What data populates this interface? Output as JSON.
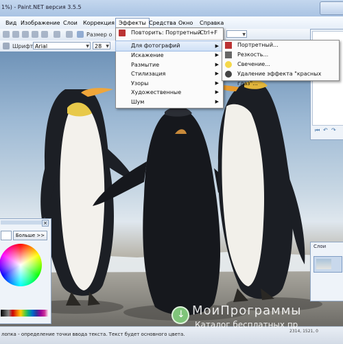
{
  "window": {
    "title": "1%) - Paint.NET версия 3.5.5"
  },
  "menu": [
    {
      "label": "Вид"
    },
    {
      "label": "Изображение"
    },
    {
      "label": "Слои"
    },
    {
      "label": "Коррекция"
    },
    {
      "label": "Эффекты"
    },
    {
      "label": "Средства"
    },
    {
      "label": "Окно"
    },
    {
      "label": "Справка"
    }
  ],
  "toolbar": {
    "size_label": "Размер о",
    "font_label": "Шрифт:",
    "font_value": "Arial",
    "size_value": "28"
  },
  "effects_menu": {
    "repeat": "Повторить: Портретный",
    "repeat_shortcut": "Ctrl+F",
    "items": [
      {
        "label": "Для фотографий"
      },
      {
        "label": "Искажение"
      },
      {
        "label": "Размытие"
      },
      {
        "label": "Стилизация"
      },
      {
        "label": "Узоры"
      },
      {
        "label": "Художественные"
      },
      {
        "label": "Шум"
      }
    ]
  },
  "photo_submenu": {
    "items": [
      {
        "label": "Портретный..."
      },
      {
        "label": "Резкость..."
      },
      {
        "label": "Свечение..."
      },
      {
        "label": "Удаление эффекта \"красных глаз\"..."
      }
    ]
  },
  "colors_panel": {
    "more_button": "Больше >>"
  },
  "layers_panel": {
    "title": "Слои"
  },
  "status": {
    "text": "лопка - определение точки ввода текста. Текст будет основного цвета.",
    "extra": "2314, 1521, 0"
  },
  "watermark": {
    "line1": "МоиПрограммы",
    "line2": "Каталог бесплатных пр"
  },
  "colors": {
    "accent": "#3a6ea5",
    "menu_highlight": "#cfe0f6",
    "menu_bg": "#fbfbfb"
  }
}
